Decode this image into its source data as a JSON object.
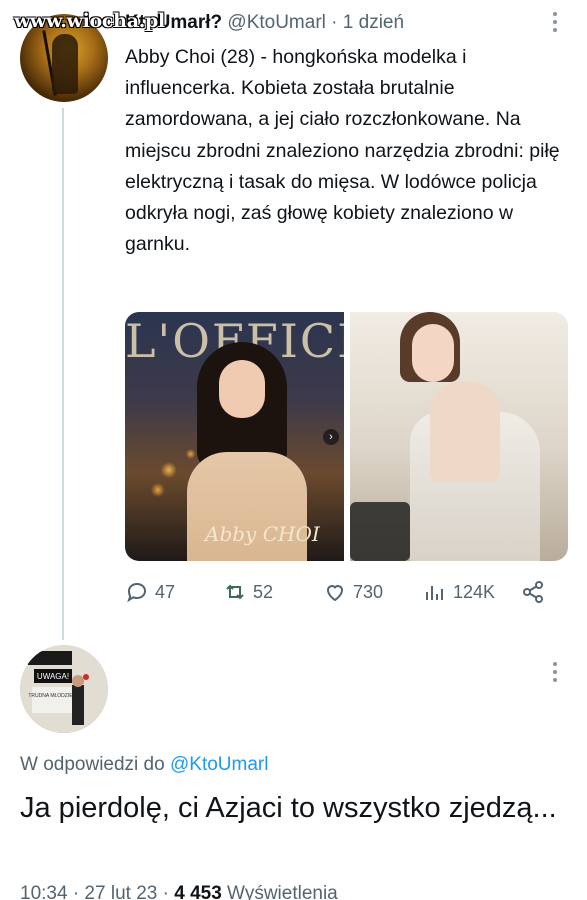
{
  "watermark": "www.wiocha.pl",
  "tweet": {
    "author_name": "KtoUmarł?",
    "handle": "@KtoUmarl",
    "separator": "·",
    "time": "1 dzień",
    "text": "Abby Choi (28) - hongkońska modelka i influencerka. Kobieta została brutalnie zamordowana, a jej ciało rozczłonkowane. Na miejscu zbrodni znaleziono narzędzia zbrodni: piłę elektryczną i tasak do mięsa. W lodówce policja odkryła nogi, zaś głowę kobiety znaleziono w garnku.",
    "media": {
      "photo1_magazine": "L'OFFICIEL",
      "photo1_cover_name": "Abby CHOI"
    },
    "actions": {
      "replies": "47",
      "retweets": "52",
      "likes": "730",
      "views": "124K"
    }
  },
  "reply": {
    "avatar_sign": "UWAGA!",
    "avatar_sign_sub": "TRUDNA MŁODZIEŻ",
    "reply_to_label": "W odpowiedzi do",
    "reply_to_handle": "@KtoUmarl",
    "text": "Ja pierdolę, ci Azjaci to wszystko zjedzą...",
    "timestamp": "10:34 · 27 lut 23 ·",
    "views_count": "4 453",
    "views_label": "Wyświetlenia"
  },
  "colors": {
    "text": "#0f1419",
    "secondary": "#536471",
    "link": "#1d9bf0",
    "thread_line": "#cfd9de"
  }
}
